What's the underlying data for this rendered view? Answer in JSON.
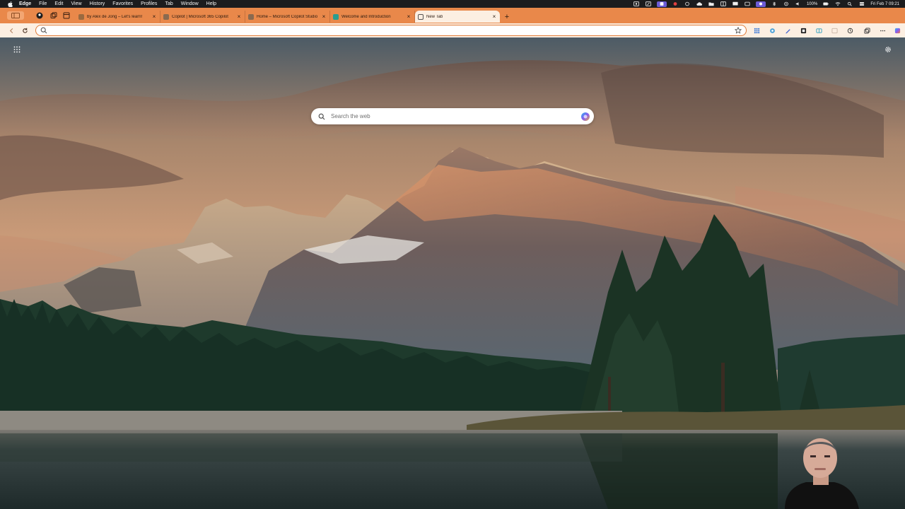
{
  "menubar": {
    "app_name": "Edge",
    "items": [
      "File",
      "Edit",
      "View",
      "History",
      "Favorites",
      "Profiles",
      "Tab",
      "Window",
      "Help"
    ],
    "battery": "100%",
    "datetime": "Fri Feb 7  09:21"
  },
  "tabs": [
    {
      "title": "by Alex de Jong – Let's learn!",
      "favicon_color": "#9a6a40",
      "active": false
    },
    {
      "title": "Copilot | Microsoft 365 Copilot",
      "favicon_color": "#8a6a50",
      "active": false
    },
    {
      "title": "Home – Microsoft Copilot Studio",
      "favicon_color": "#8a6a50",
      "active": false
    },
    {
      "title": "Welcome and Introduction",
      "favicon_color": "#2a9d8f",
      "active": false
    },
    {
      "title": "New Tab",
      "favicon_color": "#555555",
      "active": true
    }
  ],
  "tab_close_glyph": "×",
  "new_tab_glyph": "+",
  "addressbar": {
    "value": "",
    "placeholder": ""
  },
  "newtab": {
    "search_placeholder": "Search the web"
  },
  "colors": {
    "accent": "#e9884a",
    "toolbar_bg": "#fcefe2",
    "focus_ring": "#e07a36"
  }
}
